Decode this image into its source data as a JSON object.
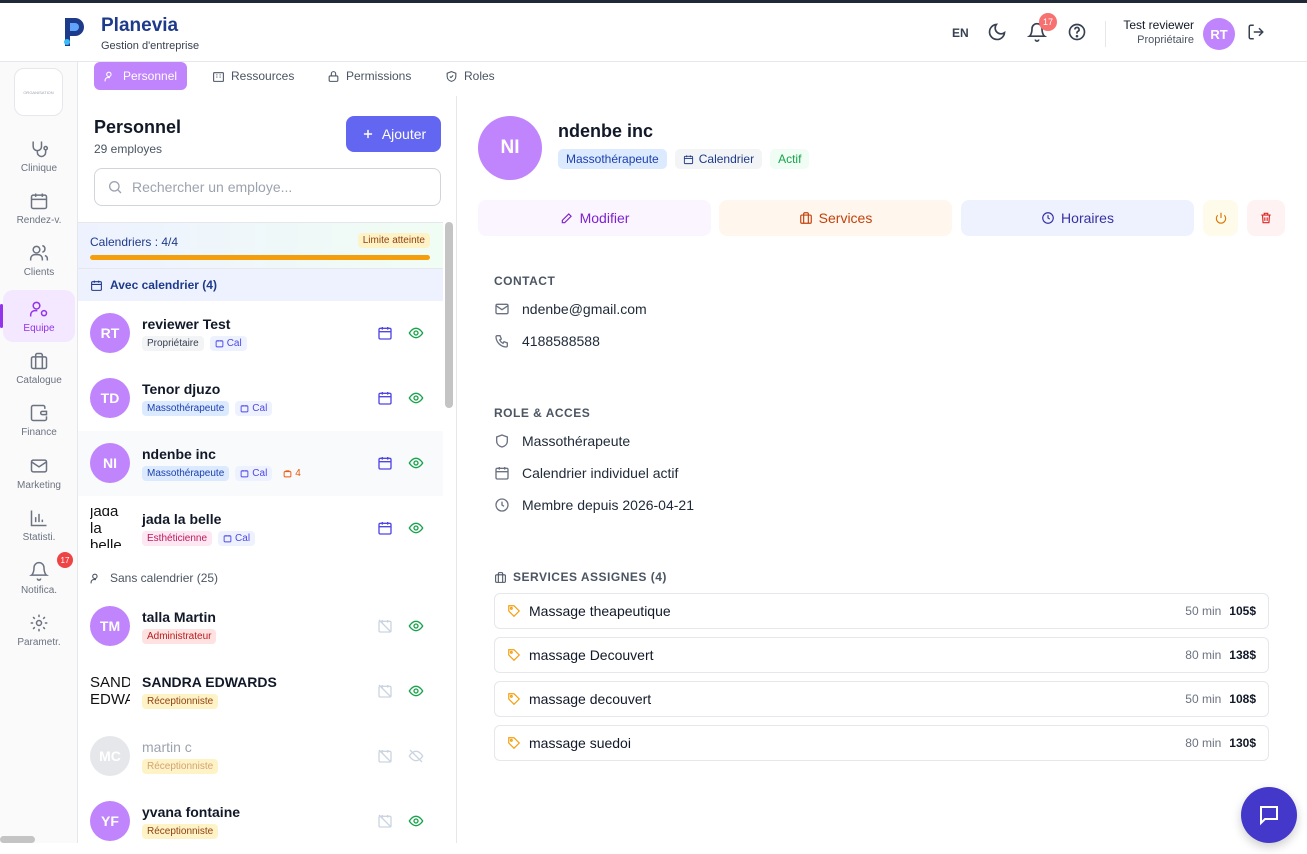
{
  "header": {
    "brand": "Planevia",
    "subtitle": "Gestion d'entreprise",
    "language": "EN",
    "notification_count": "17",
    "user_name": "Test reviewer",
    "user_role": "Propriétaire",
    "user_initials": "RT"
  },
  "sidebar": {
    "org_logo_text": "ORGANISATION",
    "items": [
      {
        "label": "Clinique",
        "icon": "stethoscope-icon"
      },
      {
        "label": "Rendez-v.",
        "icon": "calendar-icon"
      },
      {
        "label": "Clients",
        "icon": "users-icon"
      },
      {
        "label": "Equipe",
        "icon": "team-gear-icon",
        "active": true
      },
      {
        "label": "Catalogue",
        "icon": "briefcase-icon"
      },
      {
        "label": "Finance",
        "icon": "wallet-icon"
      },
      {
        "label": "Marketing",
        "icon": "mail-icon"
      },
      {
        "label": "Statisti.",
        "icon": "bar-chart-icon"
      },
      {
        "label": "Notifica.",
        "icon": "bell-icon",
        "badge": "17"
      },
      {
        "label": "Parametr.",
        "icon": "gear-icon"
      }
    ]
  },
  "tabs": [
    {
      "label": "Personnel",
      "active": true
    },
    {
      "label": "Ressources"
    },
    {
      "label": "Permissions"
    },
    {
      "label": "Roles"
    }
  ],
  "list": {
    "title": "Personnel",
    "count": "29 employes",
    "add_label": "Ajouter",
    "search_placeholder": "Rechercher un employe...",
    "quota_label": "Calendriers : 4/4",
    "quota_badge": "Limite atteinte",
    "quota_fraction": 1.0,
    "with_cal_header": "Avec calendrier (4)",
    "without_cal_header": "Sans calendrier (25)",
    "cal_tag": "Cal",
    "employees": [
      {
        "initials": "RT",
        "name": "reviewer Test",
        "role": "Propriétaire",
        "cal": true
      },
      {
        "initials": "TD",
        "name": "Tenor djuzo",
        "role": "Massothérapeute",
        "cal": true
      },
      {
        "initials": "NI",
        "name": "ndenbe inc",
        "role": "Massothérapeute",
        "cal": true,
        "services": "4"
      },
      {
        "initials": "jada la belle",
        "name": "jada la belle",
        "role": "Esthéticienne",
        "cal": true
      },
      {
        "initials": "TM",
        "name": "talla Martin",
        "role": "Administrateur",
        "cal": false
      },
      {
        "initials": "SANDRA EDWARDS",
        "name": "SANDRA EDWARDS",
        "role": "Réceptionniste",
        "cal": false
      },
      {
        "initials": "MC",
        "name": "martin c",
        "role": "Réceptionniste",
        "cal": false,
        "inactive": true
      },
      {
        "initials": "YF",
        "name": "yvana fontaine",
        "role": "Réceptionniste",
        "cal": false
      }
    ]
  },
  "detail": {
    "initials": "NI",
    "name": "ndenbe inc",
    "role": "Massothérapeute",
    "calendar_tag": "Calendrier",
    "status": "Actif",
    "btn_edit": "Modifier",
    "btn_services": "Services",
    "btn_schedule": "Horaires",
    "contact_header": "CONTACT",
    "email": "ndenbe@gmail.com",
    "phone": "4188588588",
    "role_header": "ROLE & ACCES",
    "role_line": "Massothérapeute",
    "calendar_line": "Calendrier individuel actif",
    "member_since": "Membre depuis 2026-04-21",
    "services_header": "SERVICES ASSIGNES (4)",
    "services": [
      {
        "name": "Massage theapeutique",
        "duration": "50 min",
        "price": "105$"
      },
      {
        "name": "massage Decouvert",
        "duration": "80 min",
        "price": "138$"
      },
      {
        "name": "massage decouvert",
        "duration": "50 min",
        "price": "108$"
      },
      {
        "name": "massage suedoi",
        "duration": "80 min",
        "price": "130$"
      }
    ]
  },
  "colors": {
    "accent": "#c084fc",
    "primary": "#6366f1",
    "brand": "#1e3a8a"
  }
}
